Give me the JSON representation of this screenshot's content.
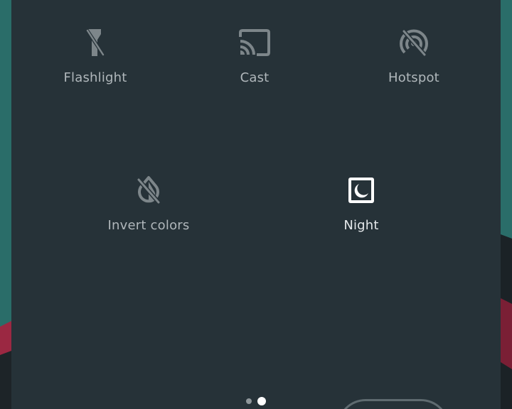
{
  "tiles": [
    {
      "id": "flashlight",
      "label": "Flashlight",
      "icon": "flashlight-off-icon",
      "active": false
    },
    {
      "id": "cast",
      "label": "Cast",
      "icon": "cast-icon",
      "active": false
    },
    {
      "id": "hotspot",
      "label": "Hotspot",
      "icon": "hotspot-off-icon",
      "active": false
    },
    {
      "id": "invert",
      "label": "Invert colors",
      "icon": "invert-colors-off-icon",
      "active": false
    },
    {
      "id": "night",
      "label": "Night",
      "icon": "night-mode-icon",
      "active": true
    }
  ],
  "pager": {
    "pages": 2,
    "current_page": 2
  },
  "colors": {
    "panel_bg": "#263238",
    "inactive_icon": "#7d868a",
    "active_icon": "#ffffff",
    "label": "#b0b7bb"
  }
}
